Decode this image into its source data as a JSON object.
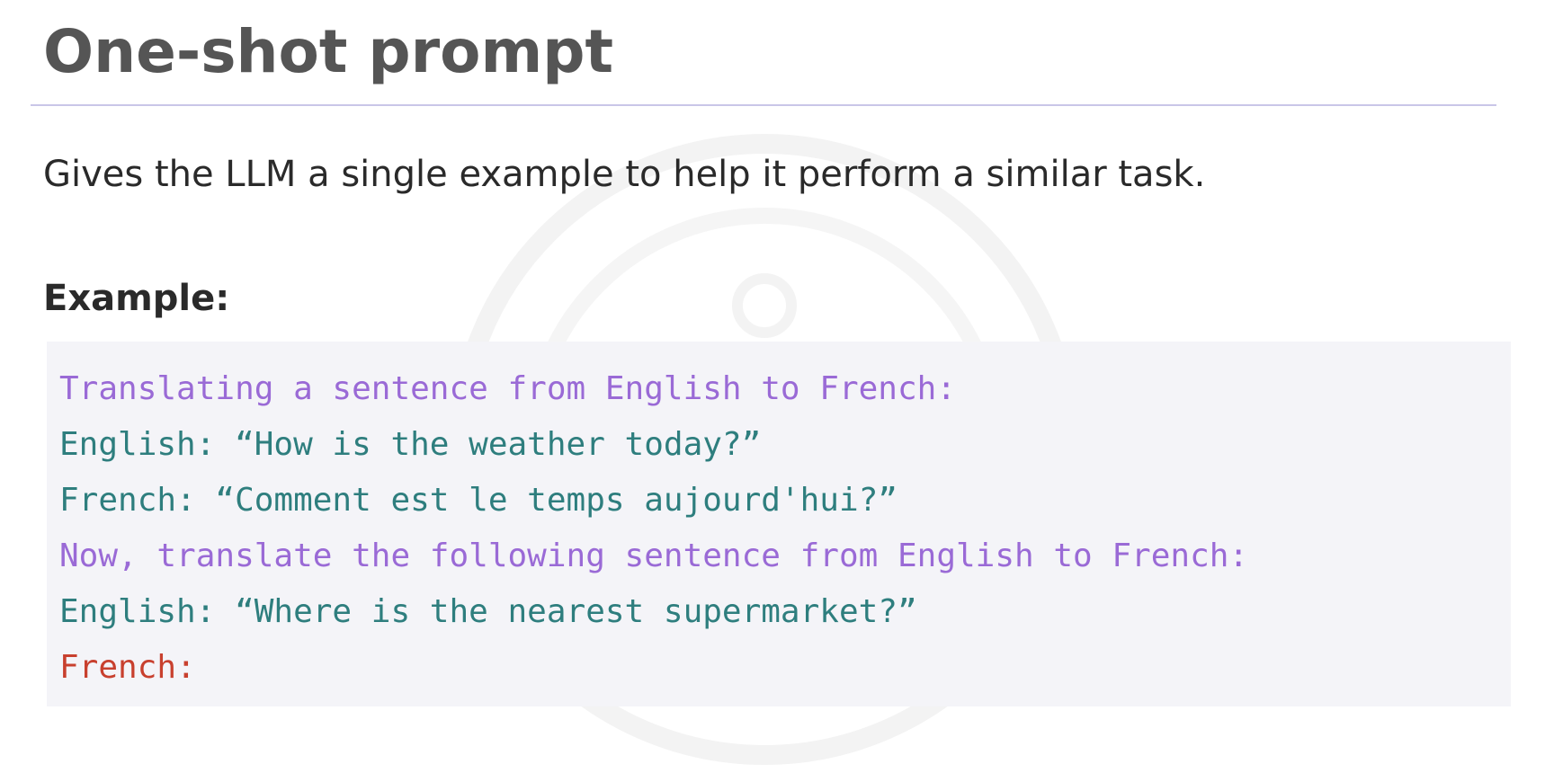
{
  "slide": {
    "title": "One-shot prompt",
    "subtitle": "Gives the LLM a single example to help it perform a similar task.",
    "example_heading": "Example:"
  },
  "code_block": {
    "lines": [
      {
        "text": "Translating a sentence from English to French:",
        "role": "instruction",
        "color": "#9a6ad6"
      },
      {
        "text": "English: “How is the weather today?”",
        "role": "example",
        "color": "#2e7e7e"
      },
      {
        "text": "French: “Comment est le temps aujourd'hui?”",
        "role": "example",
        "color": "#2e7e7e"
      },
      {
        "text": "Now, translate the following sentence from English to French:",
        "role": "instruction",
        "color": "#9a6ad6"
      },
      {
        "text": "English: “Where is the nearest supermarket?”",
        "role": "example",
        "color": "#2e7e7e"
      },
      {
        "text": "French:",
        "role": "target",
        "color": "#c8402e"
      }
    ]
  },
  "colors": {
    "title": "#555555",
    "body_text": "#2a2a2a",
    "rule": "#c9c6e8",
    "code_background": "#f4f4f8"
  }
}
